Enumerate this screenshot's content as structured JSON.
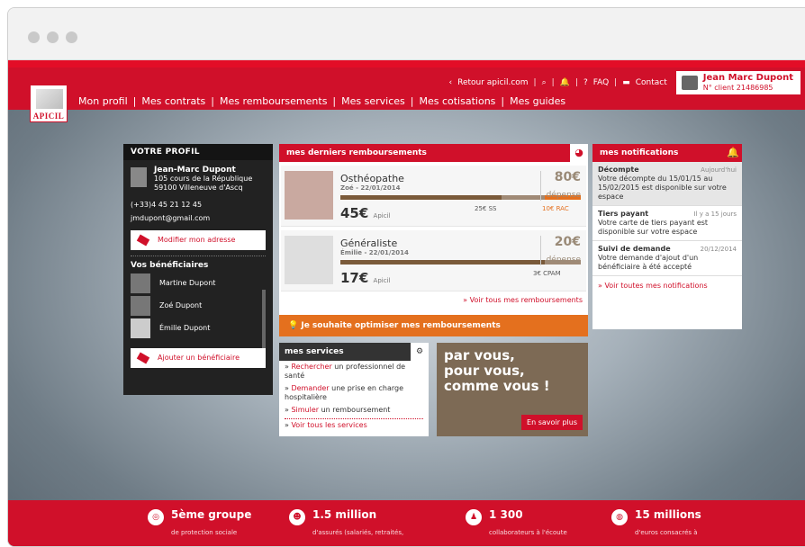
{
  "topnav": {
    "back": "Retour apicil.com",
    "faq": "FAQ",
    "contact": "Contact",
    "user_name": "Jean Marc Dupont",
    "client_no": "N° client 21486985"
  },
  "logo": {
    "text": "APICIL"
  },
  "mainnav": [
    "Mon profil",
    "Mes contrats",
    "Mes remboursements",
    "Mes services",
    "Mes cotisations",
    "Mes guides"
  ],
  "profile": {
    "title": "VOTRE PROFIL",
    "name": "Jean-Marc Dupont",
    "address1": "105 cours de la République",
    "address2": "59100 Villeneuve d'Ascq",
    "phone": "(+33)4 45 21 12 45",
    "email": "jmdupont@gmail.com",
    "edit_btn": "Modifier mon adresse",
    "benef_title": "Vos bénéficiaires",
    "benef": [
      "Martine Dupont",
      "Zoé Dupont",
      "Émilie Dupont"
    ],
    "add_btn": "Ajouter un bénéficiaire"
  },
  "remb": {
    "title": "mes derniers remboursements",
    "items": [
      {
        "title": "Osthéopathe",
        "sub": "Zoé - 22/01/2014",
        "amount": "45€",
        "unit": "Apicil",
        "total": "80€",
        "total_label": "dépense",
        "l1": "25€ SS",
        "l2": "10€ RAC"
      },
      {
        "title": "Généraliste",
        "sub": "Émilie - 22/01/2014",
        "amount": "17€",
        "unit": "Apicil",
        "total": "20€",
        "total_label": "dépense",
        "l1": "3€ CPAM",
        "l2": ""
      }
    ],
    "more": "» Voir tous mes remboursements",
    "optimize": "Je souhaite optimiser mes remboursements"
  },
  "notif": {
    "title": "mes notifications",
    "items": [
      {
        "title": "Décompte",
        "when": "Aujourd'hui",
        "text": "Votre décompte du 15/01/15 au 15/02/2015 est disponible sur votre espace"
      },
      {
        "title": "Tiers payant",
        "when": "Il y a 15 jours",
        "text": "Votre carte de tiers payant est disponible sur votre espace"
      },
      {
        "title": "Suivi de demande",
        "when": "20/12/2014",
        "text": "Votre demande d'ajout d'un bénéficiaire à été accepté"
      }
    ],
    "more": "» Voir toutes mes notifications"
  },
  "services": {
    "title": "mes services",
    "items": [
      {
        "link": "Rechercher",
        "rest": " un professionnel de santé"
      },
      {
        "link": "Demander",
        "rest": " une prise en charge hospitalière"
      },
      {
        "link": "Simuler",
        "rest": " un remboursement"
      }
    ],
    "more": "Voir tous les services"
  },
  "promo": {
    "line1": "par vous,",
    "line2": "pour vous,",
    "line3": "comme vous !",
    "btn": "En savoir plus"
  },
  "footer": [
    {
      "big": "5ème groupe",
      "small": "de protection sociale"
    },
    {
      "big": "1.5 million",
      "small": "d'assurés (salariés, retraités,"
    },
    {
      "big": "1 300",
      "small": "collaborateurs à l'écoute"
    },
    {
      "big": "15 millions",
      "small": "d'euros consacrés à"
    }
  ]
}
